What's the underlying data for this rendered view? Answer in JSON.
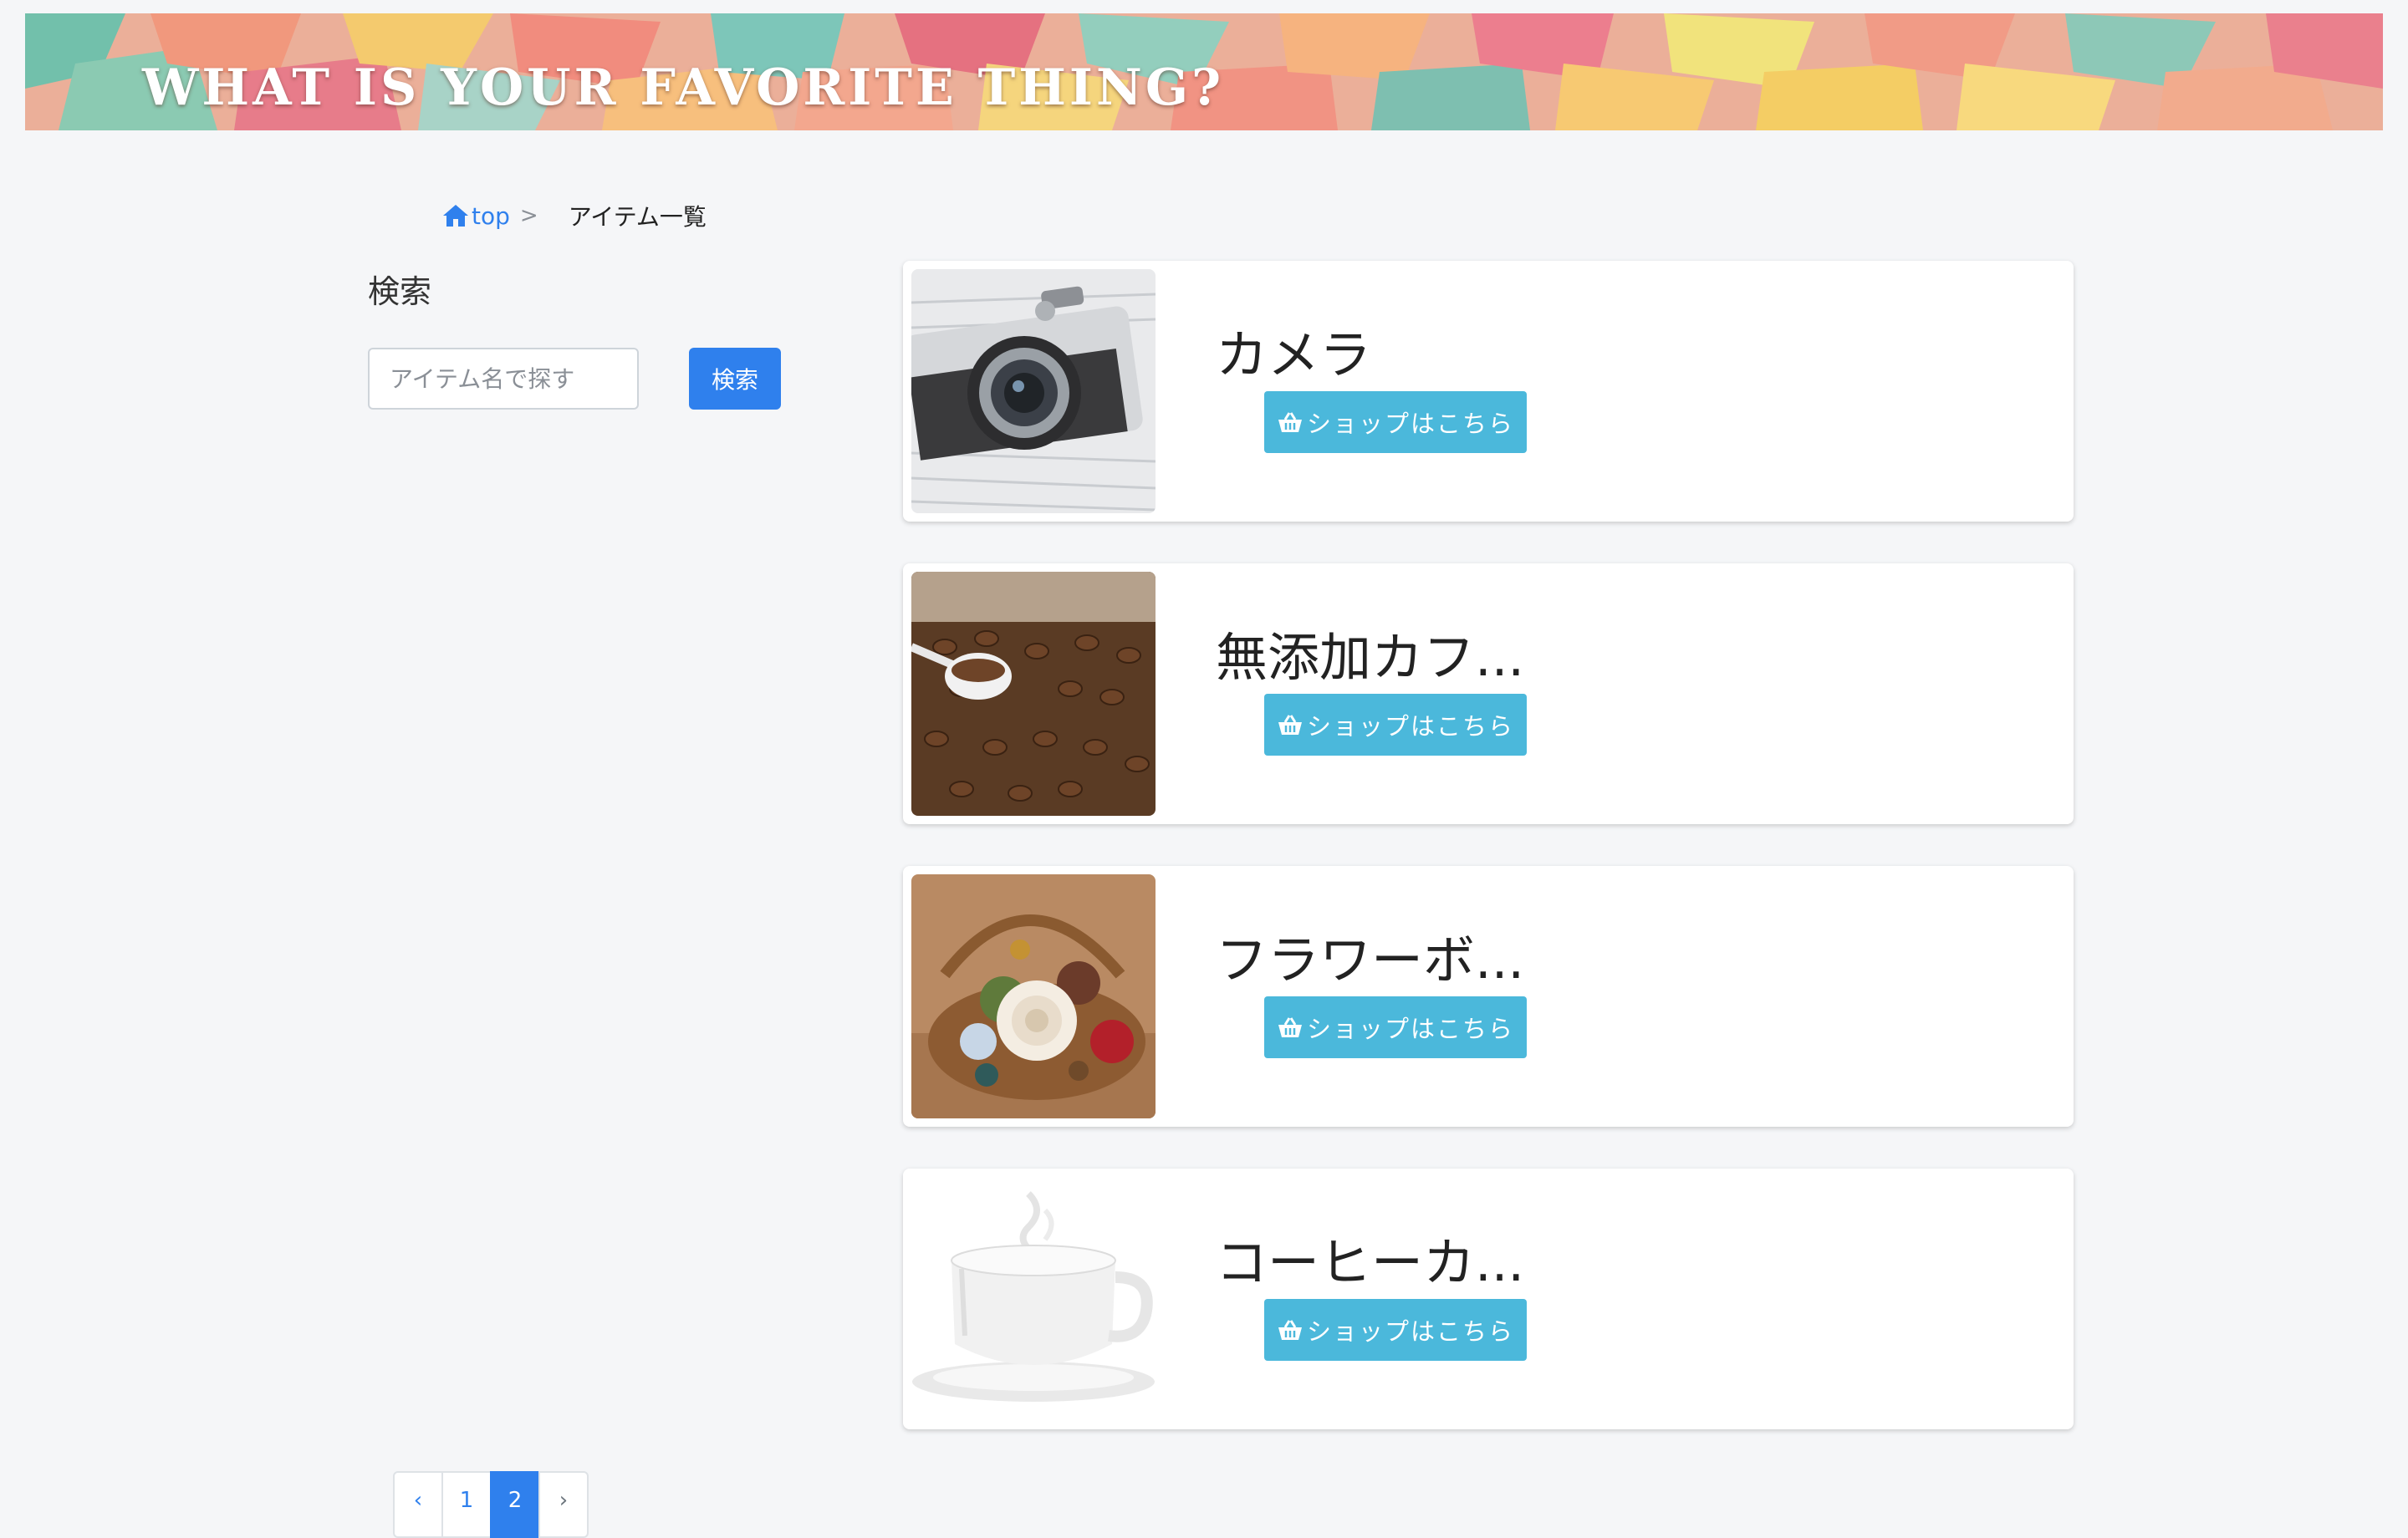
{
  "header": {
    "banner_title": "WHAT IS YOUR FAVORITE THING?"
  },
  "breadcrumb": {
    "home_label": "top",
    "separator": ">",
    "current": "アイテム一覧"
  },
  "sidebar": {
    "title": "検索",
    "search_placeholder": "アイテム名で探す",
    "search_button": "検索"
  },
  "items": [
    {
      "name": "カメラ",
      "image": "camera-image",
      "shop_label": "ショップはこちら"
    },
    {
      "name": "無添加カフ...",
      "image": "coffee-beans-image",
      "shop_label": "ショップはこちら"
    },
    {
      "name": "フラワーボ...",
      "image": "flower-basket-image",
      "shop_label": "ショップはこちら"
    },
    {
      "name": "コーヒーカ...",
      "image": "coffee-cup-image",
      "shop_label": "ショップはこちら"
    }
  ],
  "pagination": {
    "prev": "‹",
    "pages": [
      "1",
      "2"
    ],
    "current_page": "2",
    "next": "›"
  },
  "colors": {
    "accent": "#2f80ed",
    "shop_button": "#4bb8db",
    "background": "#f5f6f8"
  }
}
